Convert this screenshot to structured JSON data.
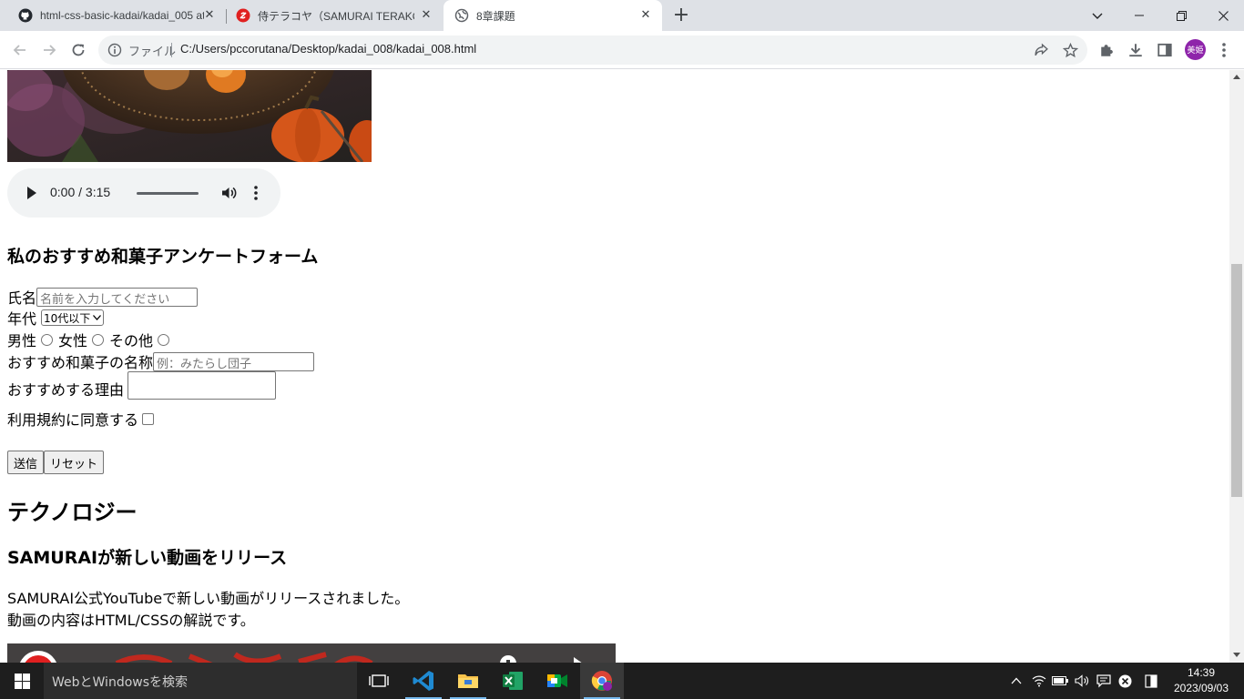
{
  "browser": {
    "tabs": [
      {
        "title": "html-css-basic-kadai/kadai_005 at",
        "icon": "github-icon"
      },
      {
        "title": "侍テラコヤ（SAMURAI TERAKOYA）",
        "icon": "samurai-icon"
      },
      {
        "title": "8章課題",
        "icon": "globe-icon",
        "active": true
      }
    ],
    "new_tab": "+",
    "omnibox": {
      "scheme": "ファイル",
      "url": "C:/Users/pccorutana/Desktop/kadai_008/kadai_008.html"
    },
    "profile_initials": "美姫"
  },
  "page": {
    "audio": {
      "time": "0:00 / 3:15"
    },
    "form": {
      "title": "私のおすすめ和菓子アンケートフォーム",
      "name_label": "氏名",
      "name_placeholder": "名前を入力してください",
      "age_label": "年代",
      "age_value": "10代以下",
      "gender": {
        "male": "男性",
        "female": "女性",
        "other": "その他"
      },
      "sweets_label": "おすすめ和菓子の名称",
      "sweets_placeholder": "例：みたらし団子",
      "reason_label": "おすすめする理由",
      "terms_label": "利用規約に同意する",
      "submit": "送信",
      "reset": "リセット"
    },
    "section_title": "テクノロジー",
    "article": {
      "title": "SAMURAIが新しい動画をリリース",
      "line1": "SAMURAI公式YouTubeで新しい動画がリリースされました。",
      "line2": "動画の内容はHTML/CSSの解説です。"
    }
  },
  "taskbar": {
    "search_placeholder": "WebとWindowsを検索",
    "time": "14:39",
    "date": "2023/09/03"
  },
  "colors": {
    "accent": "#1a73e8",
    "profile": "#8e24aa",
    "taskbar": "#1e1e1e"
  }
}
